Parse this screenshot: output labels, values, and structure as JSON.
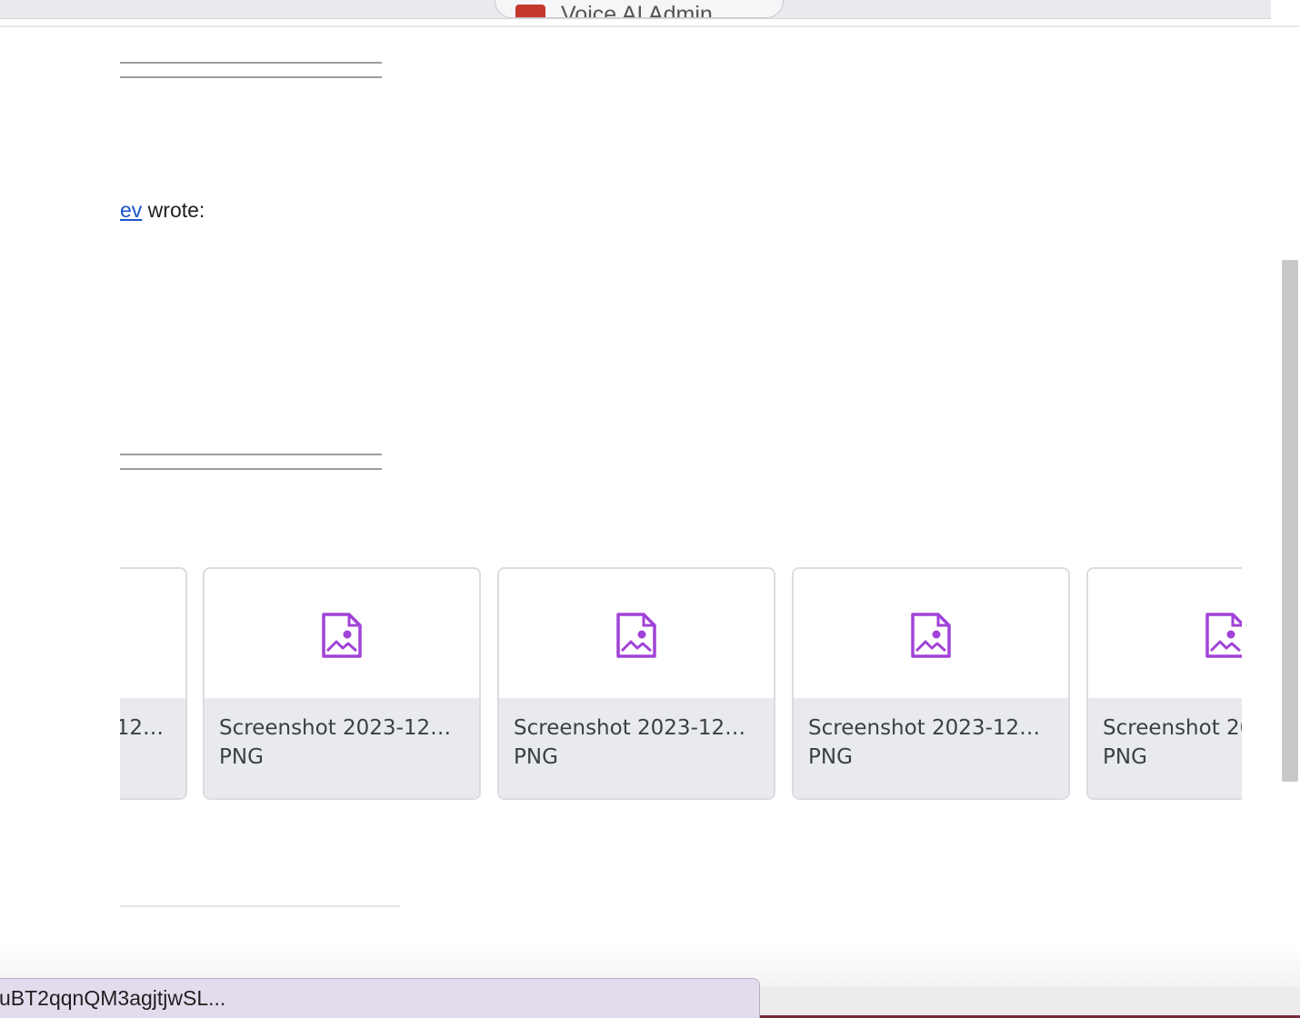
{
  "browser": {
    "tab_title": "Voice AI Admin"
  },
  "email": {
    "quote_header": {
      "author_fragment": "ev",
      "wrote_text": " wrote:"
    }
  },
  "attachments": [
    {
      "name": "12…",
      "type": ""
    },
    {
      "name": "Screenshot 2023-12…",
      "type": "PNG"
    },
    {
      "name": "Screenshot 2023-12…",
      "type": "PNG"
    },
    {
      "name": "Screenshot 2023-12…",
      "type": "PNG"
    },
    {
      "name": "Screenshot 20",
      "type": "PNG"
    }
  ],
  "status_bar": {
    "url": "uBT2qqnQM3agjtjwSL..."
  },
  "icons": {
    "attachment_icon": "image-file-icon",
    "attachment_icon_color": "#a142d8"
  }
}
